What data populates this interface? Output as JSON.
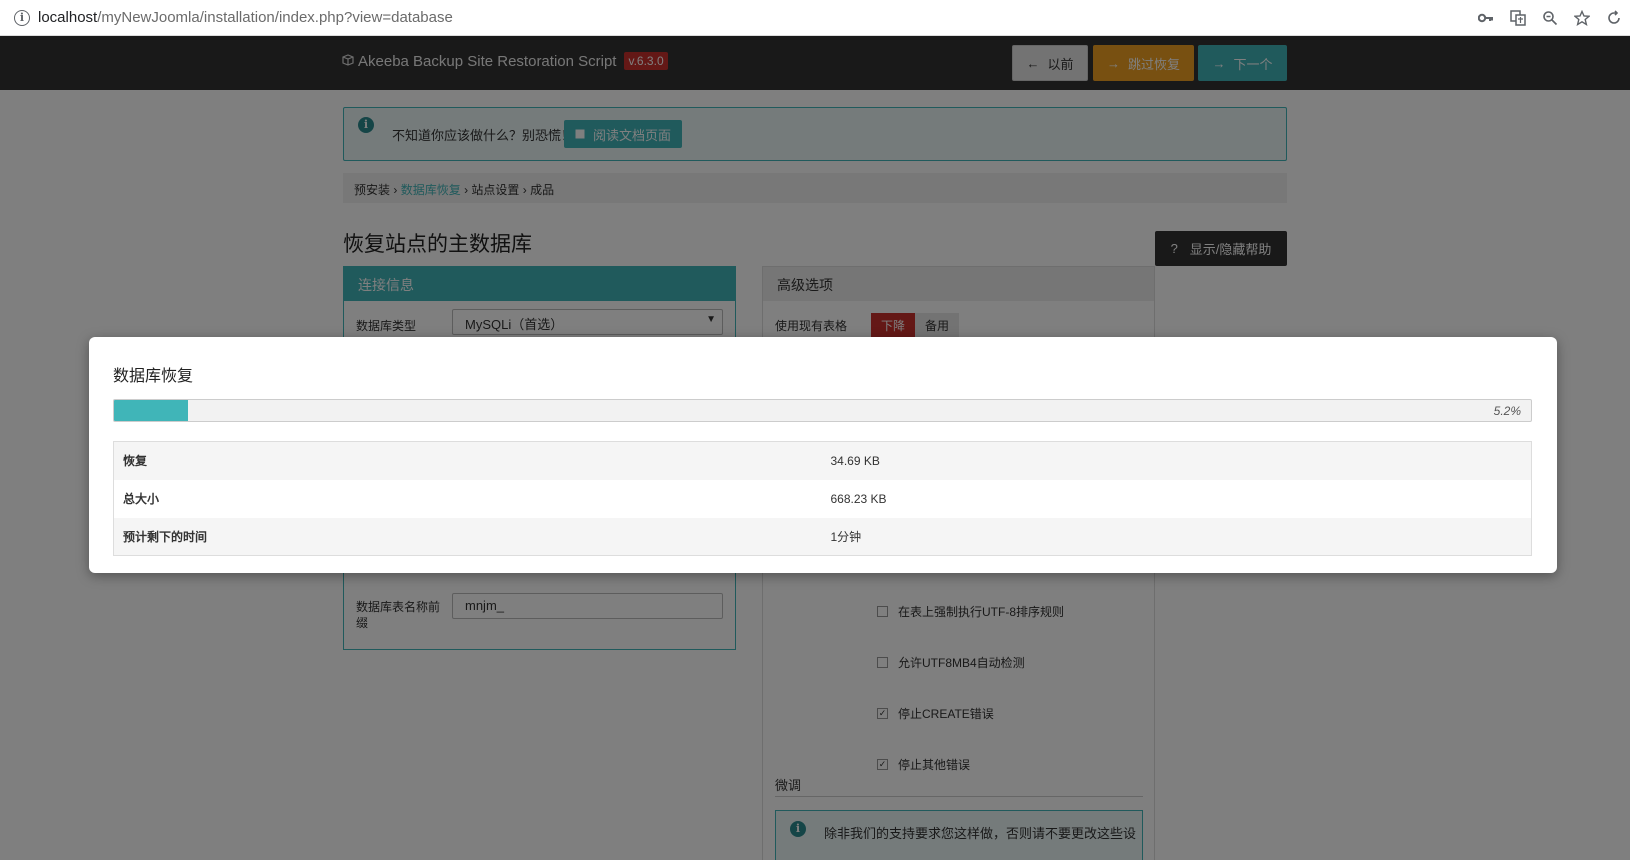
{
  "browser": {
    "url_host": "localhost",
    "url_path": "/myNewJoomla/installation/index.php?view=database"
  },
  "header": {
    "brand": "Akeeba Backup Site Restoration Script",
    "version": "v.6.3.0",
    "prev_label": "以前",
    "skip_label": "跳过恢复",
    "next_label": "下一个"
  },
  "info": {
    "text": "不知道你应该做什么？别恐慌！",
    "doc_button": "阅读文档页面"
  },
  "breadcrumb": {
    "items": [
      "预安装",
      "数据库恢复",
      "站点设置",
      "成品"
    ],
    "active_index": 1
  },
  "page": {
    "title": "恢复站点的主数据库",
    "help_button": "显示/隐藏帮助"
  },
  "connection": {
    "header": "连接信息",
    "db_type_label": "数据库类型",
    "db_type_value": "MySQLi（首选）",
    "prefix_label": "数据库表名称前缀",
    "prefix_value": "mnjm_"
  },
  "advanced": {
    "header": "高级选项",
    "existing_tables_label": "使用现有表格",
    "toggle_on": "下降",
    "toggle_off": "备用",
    "checkboxes": [
      {
        "label": "在表上强制执行UTF-8排序规则",
        "checked": false
      },
      {
        "label": "允许UTF8MB4自动检测",
        "checked": false
      },
      {
        "label": "停止CREATE错误",
        "checked": true
      },
      {
        "label": "停止其他错误",
        "checked": true
      }
    ],
    "tune_label": "微调",
    "warning_text": "除非我们的支持要求您这样做，否则请不要更改这些设"
  },
  "modal": {
    "title": "数据库恢复",
    "progress_percent": 5.2,
    "progress_label": "5.2%",
    "rows": [
      {
        "key": "恢复",
        "value": "34.69 KB"
      },
      {
        "key": "总大小",
        "value": "668.23 KB"
      },
      {
        "key": "预计剩下的时间",
        "value": "1分钟"
      }
    ]
  },
  "colors": {
    "accent": "#40b5b8",
    "danger": "#c9302c",
    "warning": "#f0a022"
  }
}
